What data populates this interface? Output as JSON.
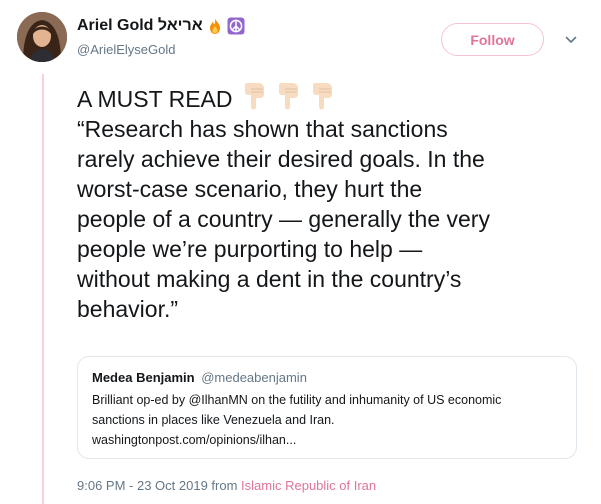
{
  "author": {
    "display_name": "Ariel Gold אריאל",
    "handle": "@ArielElyseGold",
    "badges": [
      "fire-icon",
      "peace-sign-icon"
    ]
  },
  "follow_button": {
    "label": "Follow"
  },
  "tweet": {
    "lines": [
      "A MUST READ",
      "“Research has shown that sanctions",
      "rarely achieve their desired goals. In the",
      "worst-case scenario, they hurt the",
      "people of a country — generally the very",
      "people we’re purporting to help —",
      "without making a dent in the country’s",
      "behavior.”"
    ],
    "emoji": [
      "backhand-index-pointing-down-icon",
      "backhand-index-pointing-down-icon",
      "backhand-index-pointing-down-icon"
    ]
  },
  "quoted_tweet": {
    "name": "Medea Benjamin",
    "handle": "@medeabenjamin",
    "lines": [
      "Brilliant op-ed by @IlhanMN on the futility and inhumanity of US economic",
      "sanctions in places like Venezuela and Iran.",
      "washingtonpost.com/opinions/ilhan..."
    ]
  },
  "meta": {
    "timestamp": "9:06 PM - 23 Oct 2019 from ",
    "location": "Islamic Republic of Iran"
  },
  "colors": {
    "accent": "#e0759c",
    "text": "#14171a",
    "secondary": "#657786",
    "thread_line": "#f6cfe0"
  }
}
